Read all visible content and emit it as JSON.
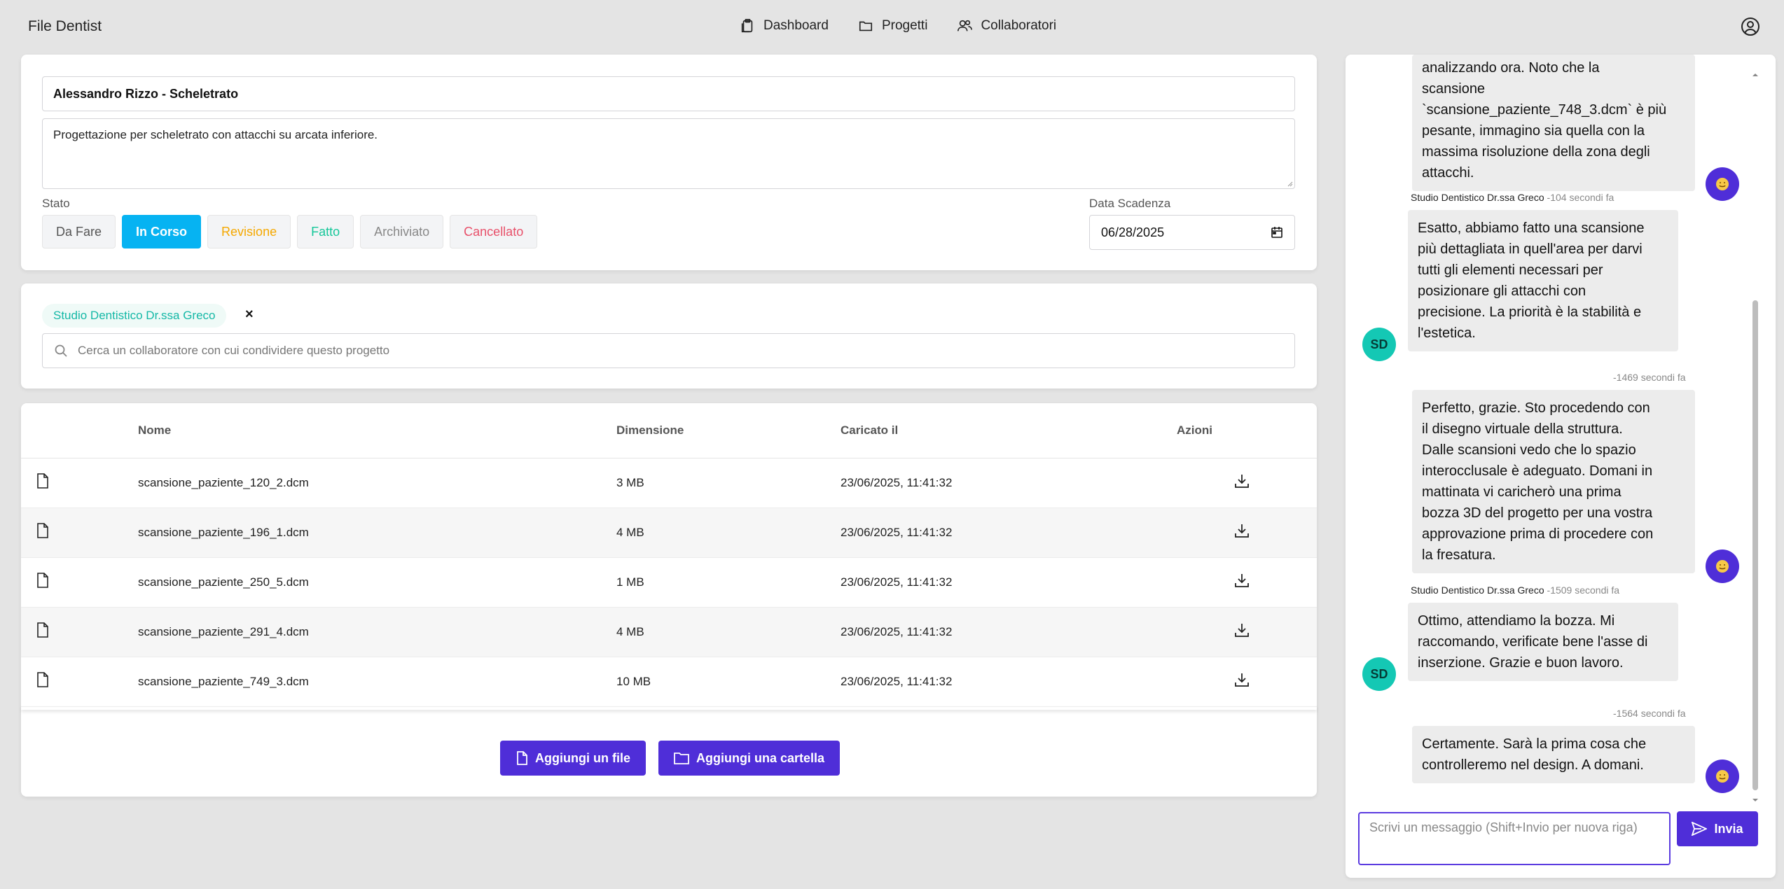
{
  "app": {
    "title": "File Dentist"
  },
  "nav": {
    "dashboard": "Dashboard",
    "projects": "Progetti",
    "collaborators": "Collaboratori"
  },
  "project": {
    "title": "Alessandro Rizzo - Scheletrato",
    "description": "Progettazione per scheletrato con attacchi su arcata inferiore.",
    "status_label": "Stato",
    "statuses": [
      "Da Fare",
      "In Corso",
      "Revisione",
      "Fatto",
      "Archiviato",
      "Cancellato"
    ],
    "active_status": "In Corso",
    "status_colors": [
      "#555555",
      "#ffffff",
      "#f5a800",
      "#16c79a",
      "#888888",
      "#e8506a"
    ],
    "active_color": "#06b3f2",
    "due_label": "Data Scadenza",
    "due_date": "06/28/2025"
  },
  "collab": {
    "chip": "Studio Dentistico Dr.ssa Greco",
    "remove": "×",
    "search_placeholder": "Cerca un collaboratore con cui condividere questo progetto"
  },
  "files": {
    "headers": {
      "name": "Nome",
      "size": "Dimensione",
      "uploaded": "Caricato il",
      "actions": "Azioni"
    },
    "rows": [
      {
        "name": "scansione_paziente_120_2.dcm",
        "size": "3 MB",
        "uploaded": "23/06/2025, 11:41:32"
      },
      {
        "name": "scansione_paziente_196_1.dcm",
        "size": "4 MB",
        "uploaded": "23/06/2025, 11:41:32"
      },
      {
        "name": "scansione_paziente_250_5.dcm",
        "size": "1 MB",
        "uploaded": "23/06/2025, 11:41:32"
      },
      {
        "name": "scansione_paziente_291_4.dcm",
        "size": "4 MB",
        "uploaded": "23/06/2025, 11:41:32"
      },
      {
        "name": "scansione_paziente_749_3.dcm",
        "size": "10 MB",
        "uploaded": "23/06/2025, 11:41:32"
      }
    ],
    "add_file": "Aggiungi un file",
    "add_folder": "Aggiungi una cartella"
  },
  "chat": {
    "messages": [
      {
        "from": "me",
        "lines": [
          "analizzando ora. Noto che la",
          "scansione",
          "`scansione_paziente_748_3.dcm` è più",
          "pesante, immagino sia quella con la",
          "massima risoluzione della zona degli",
          "attacchi."
        ]
      },
      {
        "from": "Studio Dentistico Dr.ssa Greco",
        "time": "-104 secondi fa",
        "avatar": "SD",
        "lines": [
          "Esatto, abbiamo fatto una scansione",
          "più dettagliata in quell'area per darvi",
          "tutti gli elementi necessari per",
          "posizionare gli attacchi con",
          "precisione. La priorità è la stabilità e",
          "l'estetica."
        ]
      },
      {
        "from": "me",
        "time": "-1469 secondi fa",
        "lines": [
          "Perfetto, grazie. Sto procedendo con",
          "il disegno virtuale della struttura.",
          "Dalle scansioni vedo che lo spazio",
          "interocclusale è adeguato. Domani in",
          "mattinata vi caricherò una prima",
          "bozza 3D del progetto per una vostra",
          "approvazione prima di procedere con",
          "la fresatura."
        ]
      },
      {
        "from": "Studio Dentistico Dr.ssa Greco",
        "time": "-1509 secondi fa",
        "avatar": "SD",
        "lines": [
          "Ottimo, attendiamo la bozza. Mi",
          "raccomando, verificate bene l'asse di",
          "inserzione. Grazie e buon lavoro."
        ]
      },
      {
        "from": "me",
        "time": "-1564 secondi fa",
        "lines": [
          "Certamente. Sarà la prima cosa che",
          "controlleremo nel design. A domani."
        ]
      }
    ],
    "input_placeholder": "Scrivi un messaggio (Shift+Invio per nuova riga)",
    "send": "Invia"
  }
}
